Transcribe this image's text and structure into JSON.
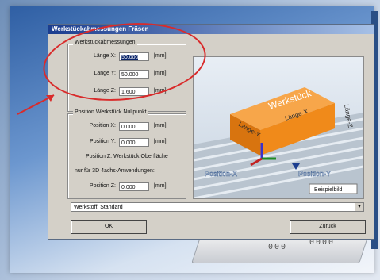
{
  "window": {
    "title": "Werkstückabmessungen Fräsen",
    "group_dimensions": {
      "legend": "Werkstückabmessungen",
      "rows": [
        {
          "label": "Länge X:",
          "value": "50.000",
          "unit": "[mm]"
        },
        {
          "label": "Länge Y:",
          "value": "50.000",
          "unit": "[mm]"
        },
        {
          "label": "Länge Z:",
          "value": "1.600",
          "unit": "[mm]"
        }
      ]
    },
    "group_zero": {
      "legend": "Position Werkstück Nullpunkt",
      "rows": [
        {
          "label": "Position X:",
          "value": "0.000",
          "unit": "[mm]"
        },
        {
          "label": "Position Y:",
          "value": "0.000",
          "unit": "[mm]"
        }
      ],
      "note1": "Position Z: Werkstück Oberfläche",
      "note2": "nur für 3D 4achs-Anwendungen:",
      "row_z": {
        "label": "Position Z:",
        "value": "0.000",
        "unit": "[mm]"
      }
    },
    "preview": {
      "box_label": "Werkstück",
      "label_laenge_x": "Länge-X",
      "label_laenge_y": "Länge-Y",
      "label_laenge_z": "Länge-Z",
      "label_pos_x": "Position-X",
      "label_pos_y": "Position-Y",
      "label_example": "Beispielbild"
    },
    "combo_value": "Werkstoff: Standard",
    "ok_label": "OK",
    "back_label": "Zurück"
  },
  "device": {
    "dots_left": "000",
    "dots_right": "0000"
  },
  "colors": {
    "highlight_ellipse": "#d92b2b",
    "box_orange": "#f08a1a",
    "title_blue": "#1b3d8f"
  }
}
